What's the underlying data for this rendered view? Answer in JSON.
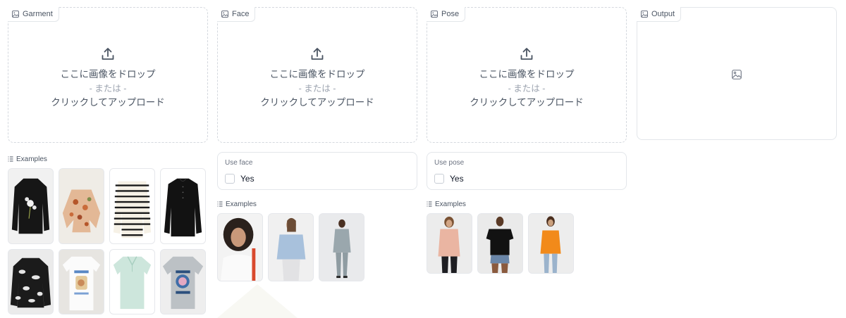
{
  "garment": {
    "label": "Garment",
    "drop_text": "ここに画像をドロップ",
    "or_text": "- または -",
    "click_text": "クリックしてアップロード",
    "examples_label": "Examples",
    "examples": [
      {
        "name": "black-floral-sweater"
      },
      {
        "name": "floral-blouse"
      },
      {
        "name": "striped-sweater"
      },
      {
        "name": "black-cardigan"
      },
      {
        "name": "black-white-print-shirt"
      },
      {
        "name": "white-graphic-tee"
      },
      {
        "name": "mint-polo-shirt"
      },
      {
        "name": "grey-graphic-tee"
      }
    ]
  },
  "face": {
    "label": "Face",
    "drop_text": "ここに画像をドロップ",
    "or_text": "- または -",
    "click_text": "クリックしてアップロード",
    "use_label": "Use face",
    "checkbox_text": "Yes",
    "examples_label": "Examples",
    "examples": [
      {
        "name": "curly-hair-woman"
      },
      {
        "name": "denim-jacket-woman"
      },
      {
        "name": "grey-suit-man"
      }
    ]
  },
  "pose": {
    "label": "Pose",
    "drop_text": "ここに画像をドロップ",
    "or_text": "- または -",
    "click_text": "クリックしてアップロード",
    "use_label": "Use pose",
    "checkbox_text": "Yes",
    "examples_label": "Examples",
    "examples": [
      {
        "name": "pink-blouse-woman"
      },
      {
        "name": "black-tee-woman"
      },
      {
        "name": "orange-top-woman"
      }
    ]
  },
  "output": {
    "label": "Output"
  }
}
